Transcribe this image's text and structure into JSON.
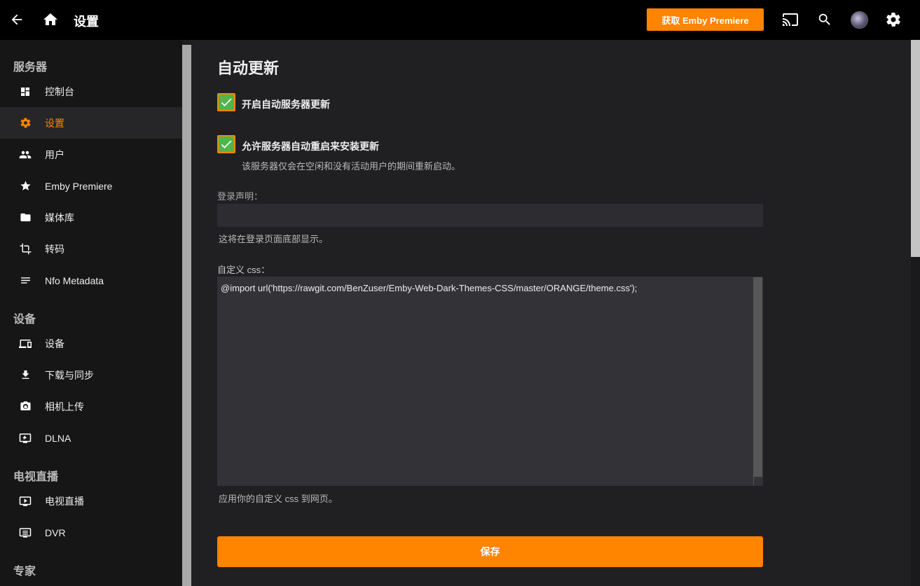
{
  "header": {
    "title": "设置",
    "premiere_label": "获取 Emby Premiere",
    "icons": [
      "back-arrow-icon",
      "home-icon",
      "cast-icon",
      "search-icon",
      "avatar",
      "gear-icon"
    ]
  },
  "sidebar": {
    "sections": [
      {
        "heading": "服务器",
        "items": [
          {
            "label": "控制台",
            "icon": "dashboard-icon"
          },
          {
            "label": "设置",
            "icon": "gear-icon",
            "active": true
          },
          {
            "label": "用户",
            "icon": "people-icon"
          },
          {
            "label": "Emby Premiere",
            "icon": "star-icon"
          },
          {
            "label": "媒体库",
            "icon": "folder-icon"
          },
          {
            "label": "转码",
            "icon": "crop-icon"
          },
          {
            "label": "Nfo Metadata",
            "icon": "lines-icon"
          }
        ]
      },
      {
        "heading": "设备",
        "items": [
          {
            "label": "设备",
            "icon": "devices-icon"
          },
          {
            "label": "下载与同步",
            "icon": "download-icon"
          },
          {
            "label": "相机上传",
            "icon": "camera-icon"
          },
          {
            "label": "DLNA",
            "icon": "screen-share-icon"
          }
        ]
      },
      {
        "heading": "电视直播",
        "items": [
          {
            "label": "电视直播",
            "icon": "tv-icon"
          },
          {
            "label": "DVR",
            "icon": "dvr-icon"
          }
        ]
      },
      {
        "heading": "专家",
        "items": []
      }
    ]
  },
  "main": {
    "section_title": "自动更新",
    "auto_update_label": "开启自动服务器更新",
    "auto_restart_label": "允许服务器自动重启来安装更新",
    "auto_restart_help": "该服务器仅会在空闲和没有活动用户的期间重新启动。",
    "login_disclaimer_label": "登录声明：",
    "login_disclaimer_value": "",
    "login_disclaimer_help": "这将在登录页面底部显示。",
    "custom_css_label": "自定义 css：",
    "custom_css_value": "@import url('https://rawgit.com/BenZuser/Emby-Web-Dark-Themes-CSS/master/ORANGE/theme.css');",
    "custom_css_help": "应用你的自定义 css 到网页。",
    "save_label": "保存"
  },
  "colors": {
    "accent": "#ff8400",
    "checkbox_fill": "#52b54b",
    "header_bg": "#000000",
    "sidebar_bg": "#161616",
    "main_bg": "#202023"
  }
}
